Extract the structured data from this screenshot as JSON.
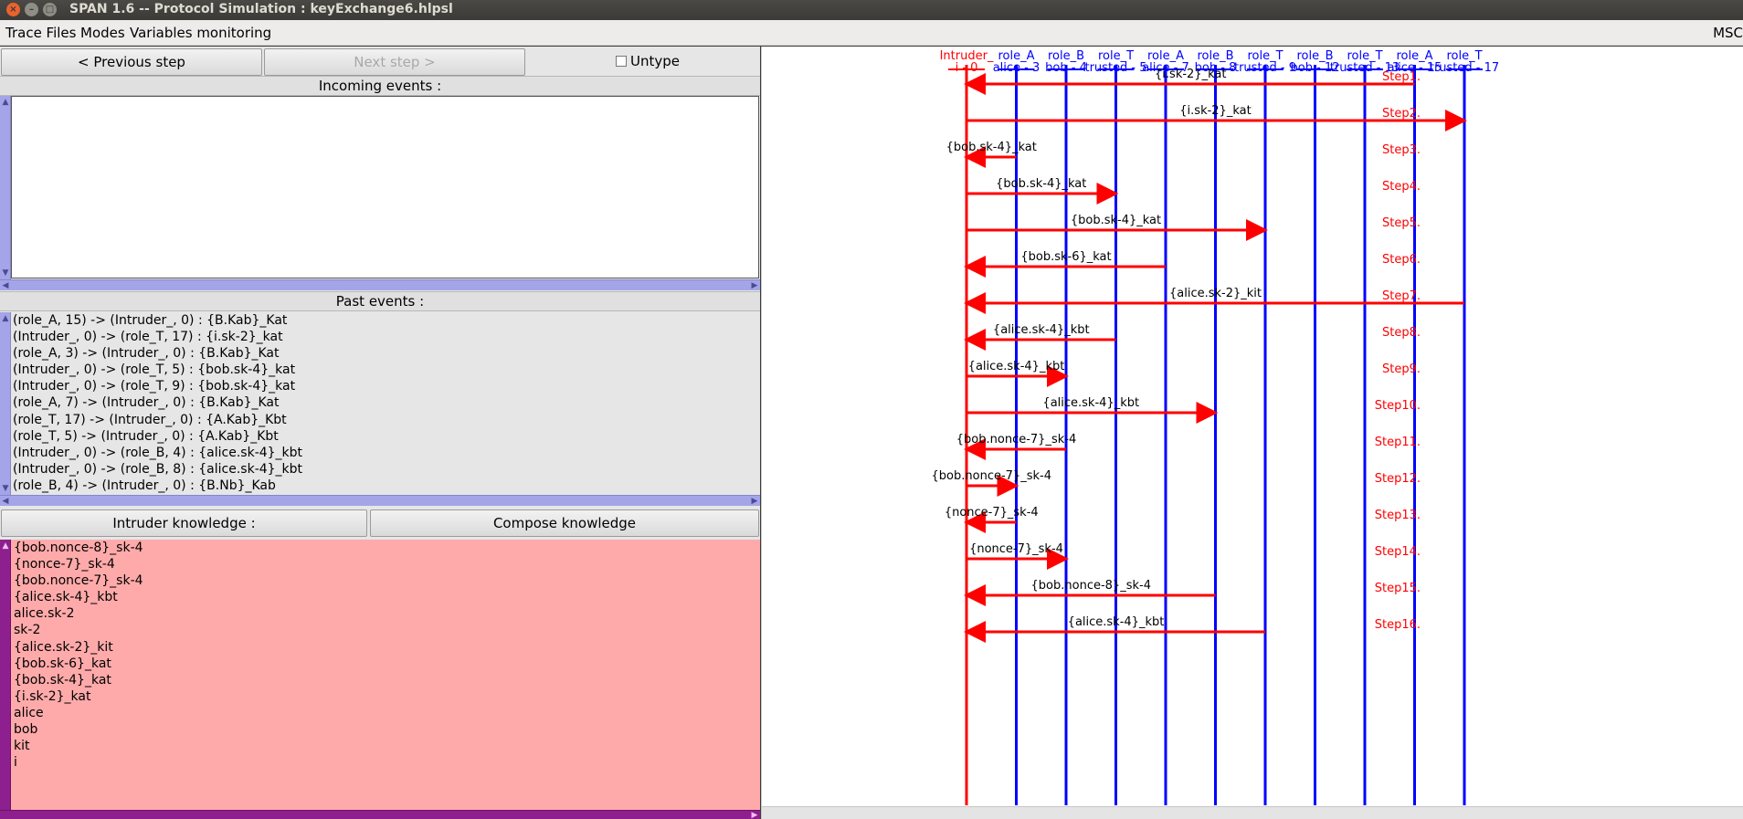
{
  "window": {
    "title": "SPAN 1.6 -- Protocol Simulation : keyExchange6.hlpsl"
  },
  "menu": {
    "items": [
      "Trace Files",
      "Modes",
      "Variables monitoring"
    ],
    "right_label": "MSC"
  },
  "controls": {
    "prev": "< Previous step",
    "next": "Next step >",
    "untype": "Untype"
  },
  "incoming": {
    "header": "Incoming events :"
  },
  "past": {
    "header": "Past events :",
    "events": [
      "(role_A, 15) -> (Intruder_, 0) : {B.Kab}_Kat",
      "(Intruder_, 0) -> (role_T, 17) : {i.sk-2}_kat",
      "(role_A, 3) -> (Intruder_, 0) : {B.Kab}_Kat",
      "(Intruder_, 0) -> (role_T, 5) : {bob.sk-4}_kat",
      "(Intruder_, 0) -> (role_T, 9) : {bob.sk-4}_kat",
      "(role_A, 7) -> (Intruder_, 0) : {B.Kab}_Kat",
      "(role_T, 17) -> (Intruder_, 0) : {A.Kab}_Kbt",
      "(role_T, 5) -> (Intruder_, 0) : {A.Kab}_Kbt",
      "(Intruder_, 0) -> (role_B, 4) : {alice.sk-4}_kbt",
      "(Intruder_, 0) -> (role_B, 8) : {alice.sk-4}_kbt",
      "(role_B, 4) -> (Intruder_, 0) : {B.Nb}_Kab"
    ]
  },
  "knowledge": {
    "header": "Intruder knowledge :",
    "compose": "Compose knowledge",
    "items": [
      "{bob.nonce-8}_sk-4",
      "{nonce-7}_sk-4",
      "{bob.nonce-7}_sk-4",
      "{alice.sk-4}_kbt",
      "alice.sk-2",
      "sk-2",
      "{alice.sk-2}_kit",
      "{bob.sk-6}_kat",
      "{bob.sk-4}_kat",
      "{i.sk-2}_kat",
      "alice",
      "bob",
      "kit",
      "i"
    ]
  },
  "msc": {
    "colors": {
      "intruder": "#ff0000",
      "agent": "#0000ff",
      "step": "#ff0000",
      "arrow": "#ff0000"
    },
    "lifelines": [
      {
        "role": "Intruder_",
        "inst": "i - 0",
        "kind": "intruder"
      },
      {
        "role": "role_A",
        "inst": "alice - 3",
        "kind": "agent"
      },
      {
        "role": "role_B",
        "inst": "bob - 4",
        "kind": "agent"
      },
      {
        "role": "role_T",
        "inst": "trusted - 5",
        "kind": "agent"
      },
      {
        "role": "role_A",
        "inst": "alice - 7",
        "kind": "agent"
      },
      {
        "role": "role_B",
        "inst": "bob - 8",
        "kind": "agent"
      },
      {
        "role": "role_T",
        "inst": "trusted - 9",
        "kind": "agent"
      },
      {
        "role": "role_B",
        "inst": "bob - 12",
        "kind": "agent"
      },
      {
        "role": "role_T",
        "inst": "trusted - 13",
        "kind": "agent"
      },
      {
        "role": "role_A",
        "inst": "alice - 15",
        "kind": "agent"
      },
      {
        "role": "role_T",
        "inst": "trusted - 17",
        "kind": "agent"
      }
    ],
    "steps": [
      {
        "label": "Step1.",
        "from": 9,
        "to": 0,
        "msg": "{i.sk-2}_kat"
      },
      {
        "label": "Step2.",
        "from": 0,
        "to": 10,
        "msg": "{i.sk-2}_kat"
      },
      {
        "label": "Step3.",
        "from": 1,
        "to": 0,
        "msg": "{bob.sk-4}_kat"
      },
      {
        "label": "Step4.",
        "from": 0,
        "to": 3,
        "msg": "{bob.sk-4}_kat"
      },
      {
        "label": "Step5.",
        "from": 0,
        "to": 6,
        "msg": "{bob.sk-4}_kat"
      },
      {
        "label": "Step6.",
        "from": 4,
        "to": 0,
        "msg": "{bob.sk-6}_kat"
      },
      {
        "label": "Step7.",
        "from": 10,
        "to": 0,
        "msg": "{alice.sk-2}_kit"
      },
      {
        "label": "Step8.",
        "from": 3,
        "to": 0,
        "msg": "{alice.sk-4}_kbt"
      },
      {
        "label": "Step9.",
        "from": 0,
        "to": 2,
        "msg": "{alice.sk-4}_kbt"
      },
      {
        "label": "Step10.",
        "from": 0,
        "to": 5,
        "msg": "{alice.sk-4}_kbt"
      },
      {
        "label": "Step11.",
        "from": 2,
        "to": 0,
        "msg": "{bob.nonce-7}_sk-4"
      },
      {
        "label": "Step12.",
        "from": 0,
        "to": 1,
        "msg": "{bob.nonce-7}_sk-4"
      },
      {
        "label": "Step13.",
        "from": 1,
        "to": 0,
        "msg": "{nonce-7}_sk-4"
      },
      {
        "label": "Step14.",
        "from": 0,
        "to": 2,
        "msg": "{nonce-7}_sk-4"
      },
      {
        "label": "Step15.",
        "from": 5,
        "to": 0,
        "msg": "{bob.nonce-8}_sk-4"
      },
      {
        "label": "Step16.",
        "from": 6,
        "to": 0,
        "msg": "{alice.sk-4}_kbt"
      }
    ]
  }
}
